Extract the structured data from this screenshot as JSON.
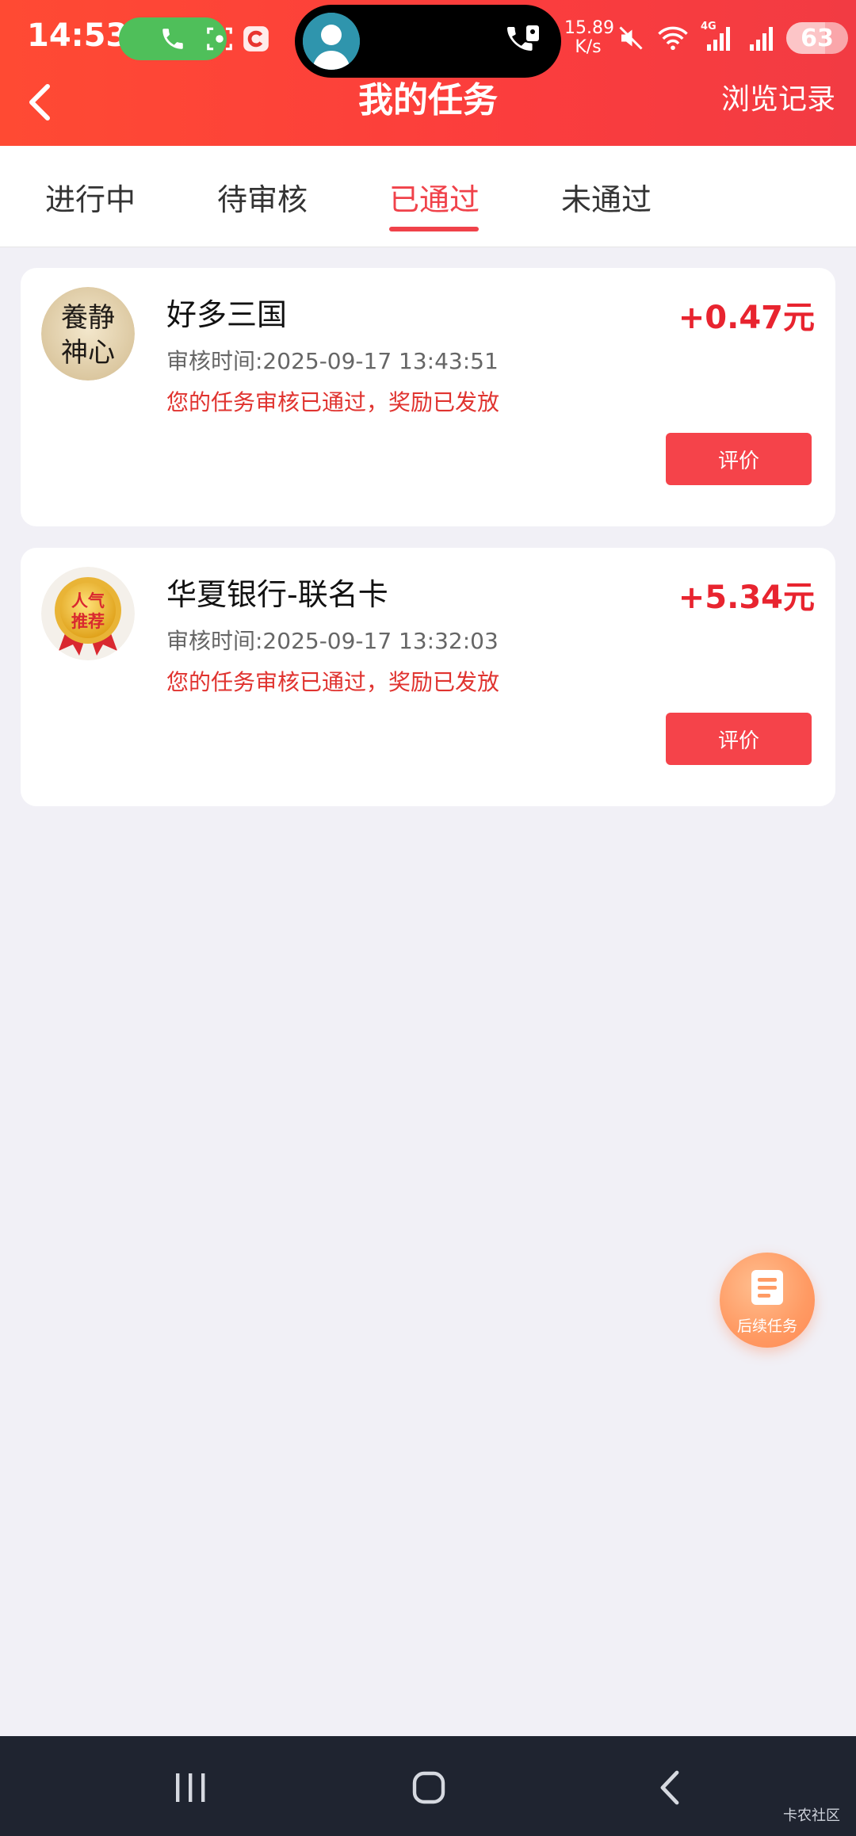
{
  "status_bar": {
    "time": "14:53",
    "net_speed_value": "15.89",
    "net_speed_unit": "K/s",
    "battery": "63",
    "network_label": "4G"
  },
  "header": {
    "title": "我的任务",
    "history_link": "浏览记录"
  },
  "tabs": [
    {
      "label": "进行中",
      "active": false
    },
    {
      "label": "待审核",
      "active": false
    },
    {
      "label": "已通过",
      "active": true
    },
    {
      "label": "未通过",
      "active": false
    }
  ],
  "tasks": [
    {
      "name": "好多三国",
      "amount": "+0.47元",
      "review_time": "审核时间:2025-09-17 13:43:51",
      "status": "您的任务审核已通过，奖励已发放",
      "button": "评价",
      "avatar_text_lines": [
        "養静",
        "神心"
      ]
    },
    {
      "name": "华夏银行-联名卡",
      "amount": "+5.34元",
      "review_time": "审核时间:2025-09-17 13:32:03",
      "status": "您的任务审核已通过，奖励已发放",
      "button": "评价",
      "avatar_text_lines": [
        "人气",
        "推荐"
      ]
    }
  ],
  "fab": {
    "label": "后续任务",
    "icon": "document-list-icon"
  },
  "bottom_nav": {
    "watermark": "卡农社区"
  },
  "colors": {
    "header_red": "#fb3d3d",
    "accent_red": "#f0424a",
    "amount_red": "#e8242f",
    "call_green": "#4fbf5a",
    "fab_orange": "#ff9a63"
  }
}
